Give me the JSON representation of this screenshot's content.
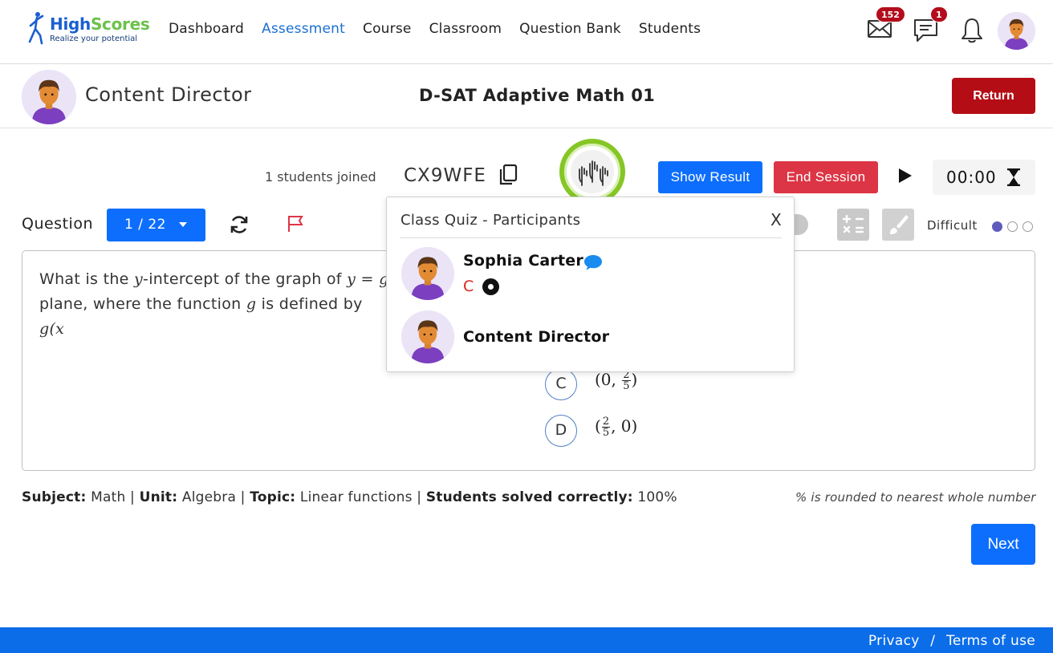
{
  "brand": {
    "name_part1": "High",
    "name_part2": "Scores",
    "tagline": "Realize your potential"
  },
  "nav": {
    "items": [
      {
        "label": "Dashboard",
        "active": false
      },
      {
        "label": "Assessment",
        "active": true
      },
      {
        "label": "Course",
        "active": false
      },
      {
        "label": "Classroom",
        "active": false
      },
      {
        "label": "Question Bank",
        "active": false
      },
      {
        "label": "Students",
        "active": false
      }
    ]
  },
  "notifications": {
    "mail_count": "152",
    "messages_count": "1"
  },
  "header": {
    "user_name": "Content Director",
    "title": "D-SAT Adaptive Math 01",
    "return_label": "Return"
  },
  "session": {
    "joined_text": "1 students joined",
    "code": "CX9WFE",
    "show_result_label": "Show Result",
    "end_session_label": "End Session",
    "timer": "00:00"
  },
  "question_bar": {
    "label": "Question",
    "current": "1 / 22",
    "difficulty_label": "Difficult",
    "difficulty_level": 1,
    "difficulty_max": 3
  },
  "question": {
    "line1_prefix": "What is the ",
    "line1_var": "y",
    "line1_suffix": "-intercept of the graph of ",
    "line1_eq": "y = g",
    "line2_prefix": "plane, where the function ",
    "line2_var": "g",
    "line2_suffix": " is defined by ",
    "line2_eq": "g(x",
    "choices": [
      {
        "letter": "C",
        "open": "(0, ",
        "num": "2",
        "den": "5",
        "close": ")"
      },
      {
        "letter": "D",
        "open": "(",
        "num": "2",
        "den": "5",
        "close": ", 0)"
      }
    ]
  },
  "meta": {
    "subject_label": "Subject:",
    "subject": "Math",
    "unit_label": "Unit:",
    "unit": "Algebra",
    "topic_label": "Topic:",
    "topic": "Linear functions",
    "solved_label": "Students solved correctly:",
    "solved": "100%",
    "sep": "|",
    "rounding_note": "% is rounded to nearest whole number"
  },
  "next_label": "Next",
  "popup": {
    "title": "Class Quiz - Participants",
    "close": "X",
    "participants": [
      {
        "name": "Sophia Carter",
        "answer": "C"
      },
      {
        "name": "Content Director"
      }
    ]
  },
  "footer": {
    "privacy": "Privacy",
    "sep": "/",
    "terms": "Terms of use"
  },
  "colors": {
    "primary": "#0d6efd",
    "danger": "#dc3545",
    "return": "#b50d15",
    "footer": "#0c6de8",
    "ring": "#86c625",
    "difficulty": "#5f5bbd"
  }
}
